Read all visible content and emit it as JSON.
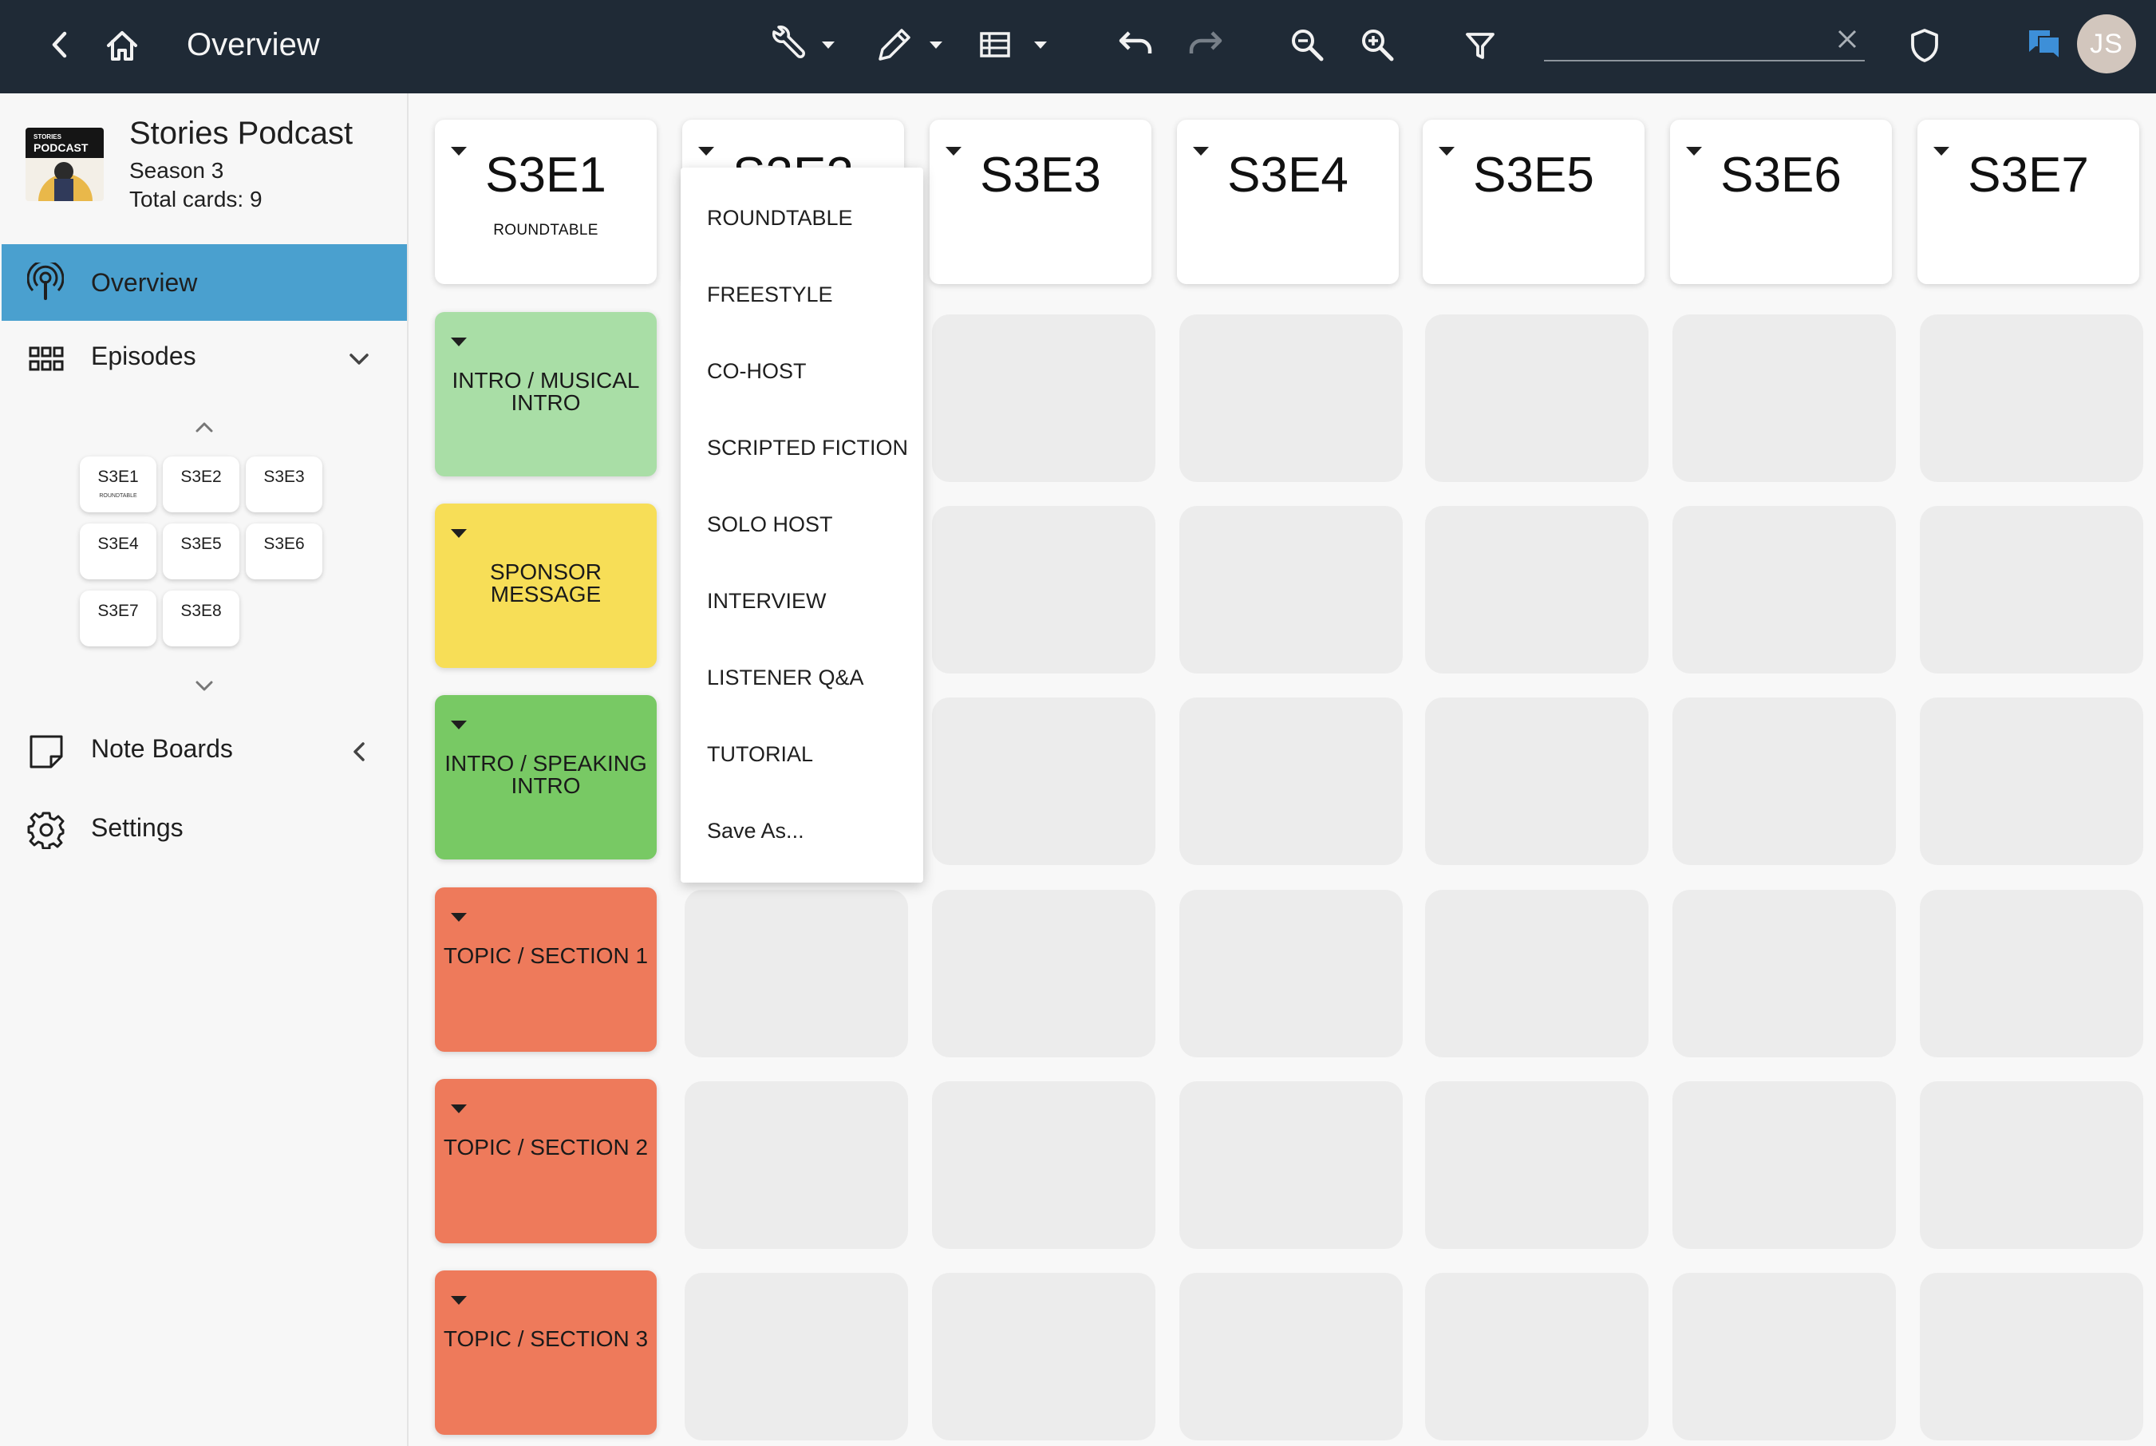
{
  "topbar": {
    "title": "Overview",
    "search_value": "",
    "user_initials": "JS",
    "icons": [
      "back-arrow-icon",
      "home-icon",
      "wrench-icon",
      "pencil-icon",
      "table-icon",
      "undo-icon",
      "redo-icon",
      "zoom-out-icon",
      "zoom-in-icon",
      "filter-icon",
      "clear-icon",
      "shield-icon",
      "chat-icon"
    ]
  },
  "podcast": {
    "name": "Stories Podcast",
    "season": "Season 3",
    "total_cards": "Total cards: 9",
    "logo_top": "STORIES",
    "logo_main": "PODCAST"
  },
  "sidebar": {
    "overview": "Overview",
    "episodes": "Episodes",
    "note_boards": "Note Boards",
    "settings": "Settings",
    "mini_cards": [
      {
        "title": "S3E1",
        "sub": "ROUNDTABLE"
      },
      {
        "title": "S3E2",
        "sub": ""
      },
      {
        "title": "S3E3",
        "sub": ""
      },
      {
        "title": "S3E4",
        "sub": ""
      },
      {
        "title": "S3E5",
        "sub": ""
      },
      {
        "title": "S3E6",
        "sub": ""
      },
      {
        "title": "S3E7",
        "sub": ""
      },
      {
        "title": "S3E8",
        "sub": ""
      }
    ]
  },
  "board": {
    "episodes": [
      {
        "title": "S3E1",
        "type": "ROUNDTABLE"
      },
      {
        "title": "S3E2",
        "type": ""
      },
      {
        "title": "S3E3",
        "type": ""
      },
      {
        "title": "S3E4",
        "type": ""
      },
      {
        "title": "S3E5",
        "type": ""
      },
      {
        "title": "S3E6",
        "type": ""
      },
      {
        "title": "S3E7",
        "type": ""
      }
    ],
    "segments": [
      {
        "label": "INTRO / MUSICAL INTRO",
        "color": "#a9dea6"
      },
      {
        "label": "SPONSOR MESSAGE",
        "color": "#f7de57"
      },
      {
        "label": "INTRO / SPEAKING INTRO",
        "color": "#78c964"
      },
      {
        "label": "TOPIC / SECTION 1",
        "color": "#ee7a5b"
      },
      {
        "label": "TOPIC / SECTION 2",
        "color": "#ee7a5b"
      },
      {
        "label": "TOPIC / SECTION 3",
        "color": "#ee7a5b"
      }
    ]
  },
  "dropdown": {
    "items": [
      "ROUNDTABLE",
      "FREESTYLE",
      "CO-HOST",
      "SCRIPTED FICTION",
      "SOLO HOST",
      "INTERVIEW",
      "LISTENER Q&A",
      "TUTORIAL",
      "Save As..."
    ]
  },
  "colors": {
    "topbar": "#1f2a36",
    "accent": "#4aa0cf",
    "chat_icon": "#3d8fd8",
    "slot": "#ececec"
  }
}
